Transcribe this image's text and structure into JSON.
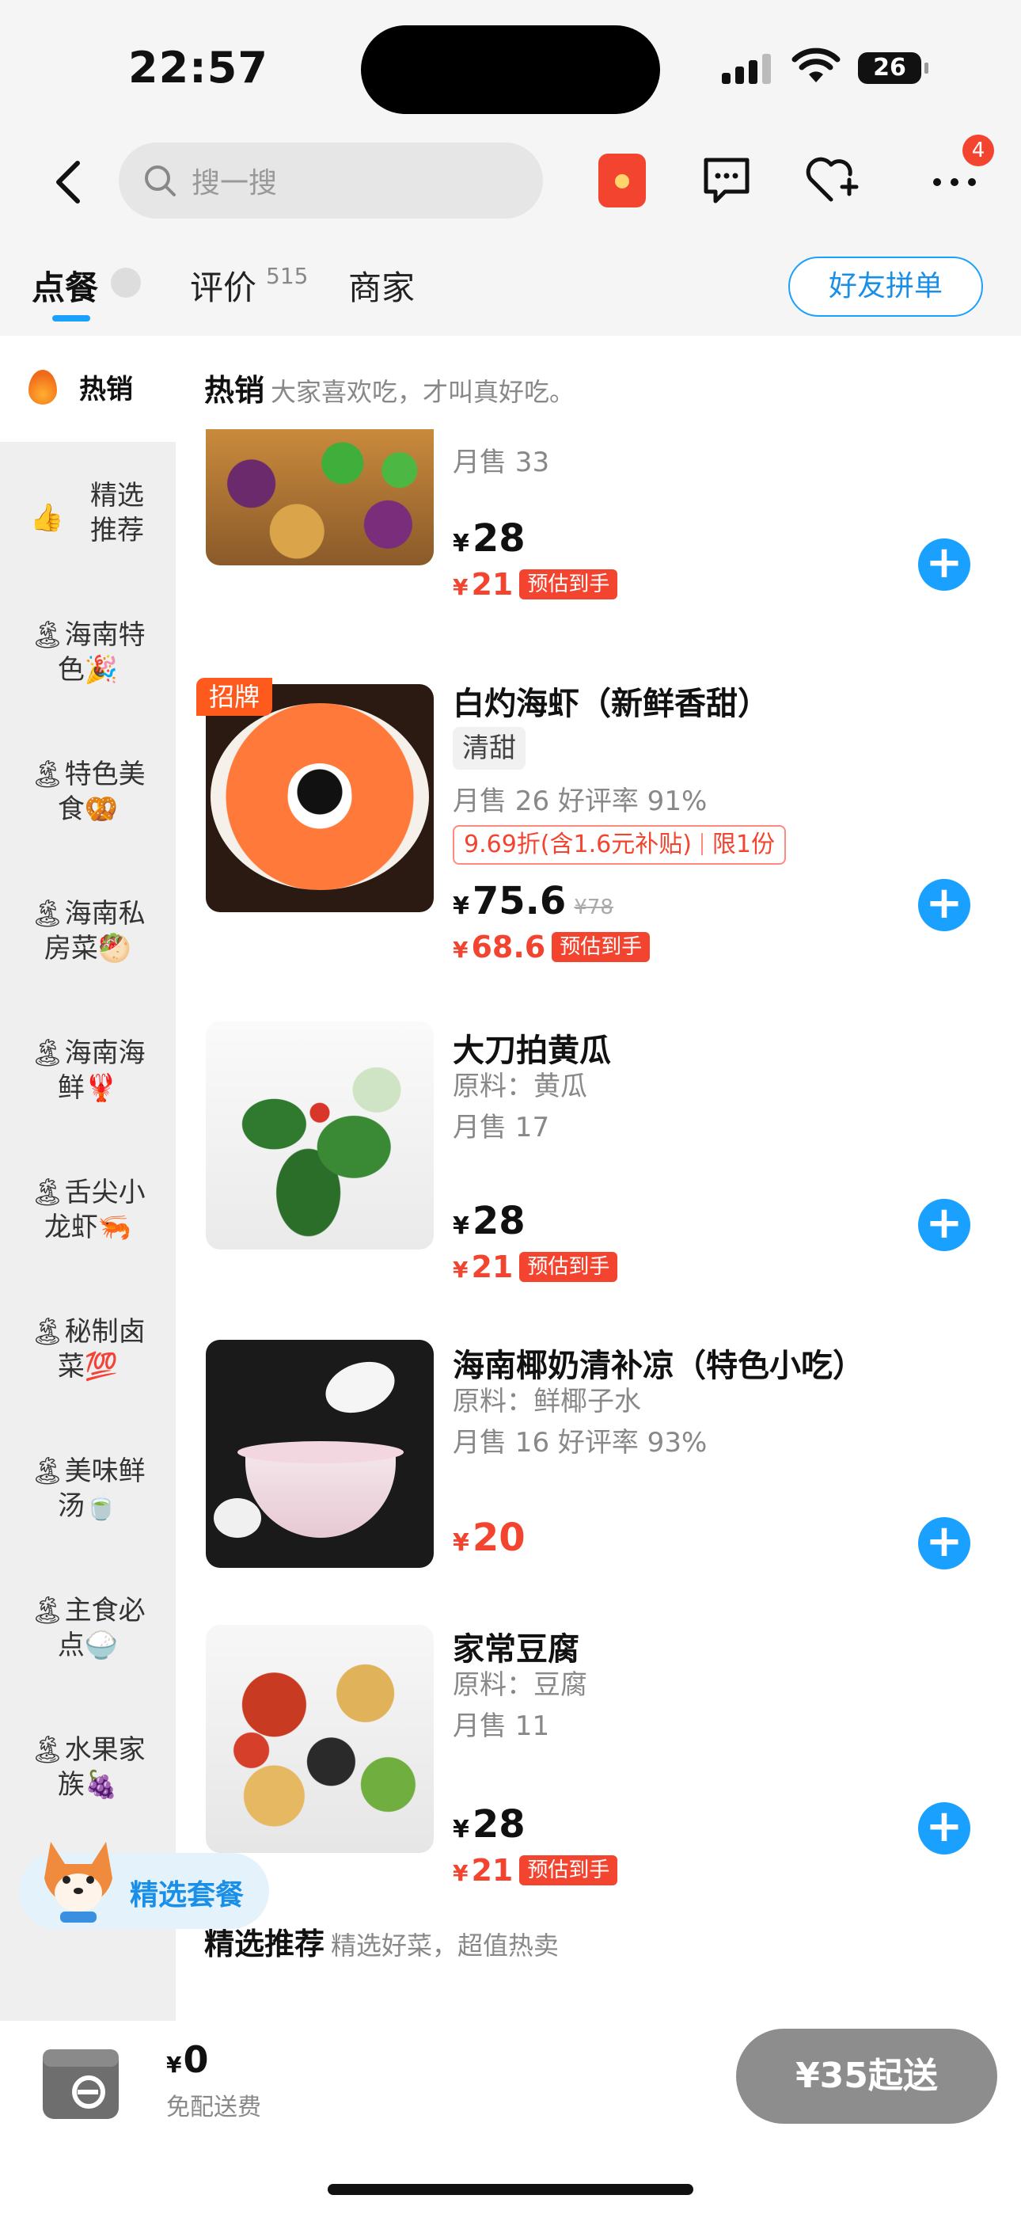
{
  "status_bar": {
    "time": "22:57",
    "battery": "26"
  },
  "nav": {
    "search_placeholder": "搜一搜",
    "notification_count": "4"
  },
  "tabs": [
    {
      "label": "点餐"
    },
    {
      "label": "评价",
      "count": "515"
    },
    {
      "label": "商家"
    }
  ],
  "friend_order_button": "好友拼单",
  "sidebar": {
    "items": [
      {
        "label": "热销"
      },
      {
        "label": "精选推荐"
      },
      {
        "label": "🏝海南特色🎉"
      },
      {
        "label": "🏝特色美食🥨"
      },
      {
        "label": "🏝海南私房菜🥙"
      },
      {
        "label": "🏝海南海鲜🦞"
      },
      {
        "label": "🏝舌尖小龙虾🦐"
      },
      {
        "label": "🏝秘制卤菜💯"
      },
      {
        "label": "🏝美味鲜汤🍵"
      },
      {
        "label": "🏝主食必点🍚"
      },
      {
        "label": "🏝水果家族🍇"
      }
    ]
  },
  "section_hot": {
    "title": "热销",
    "subtitle": "大家喜欢吃，才叫真好吃。"
  },
  "dishes": [
    {
      "name": "",
      "sold": "月售 33",
      "price": "28",
      "estimated_price": "21",
      "estimate_label": "预估到手"
    },
    {
      "badge": "招牌",
      "name": "白灼海虾（新鲜香甜）",
      "tag": "清甜",
      "sold": "月售 26 好评率 91%",
      "promo_discount": "9.69折(含1.6元补贴)",
      "promo_limit": "限1份",
      "price": "75.6",
      "original_price": "¥78",
      "estimated_price": "68.6",
      "estimate_label": "预估到手"
    },
    {
      "name": "大刀拍黄瓜",
      "ingredients": "原料：黄瓜",
      "sold": "月售 17",
      "price": "28",
      "estimated_price": "21",
      "estimate_label": "预估到手"
    },
    {
      "name": "海南椰奶清补凉（特色小吃）",
      "ingredients": "原料：鲜椰子水",
      "sold": "月售 16 好评率 93%",
      "price": "20"
    },
    {
      "name": "家常豆腐",
      "ingredients": "原料：豆腐",
      "sold": "月售 11",
      "price": "28",
      "estimated_price": "21",
      "estimate_label": "预估到手"
    }
  ],
  "section_recommend": {
    "title": "精选推荐",
    "subtitle": "精选好菜，超值热卖"
  },
  "floating_set": {
    "label": "精选套餐"
  },
  "cart": {
    "currency": "¥",
    "total": "0",
    "delivery_note": "免配送费",
    "min_order_button": "¥35起送"
  },
  "colors": {
    "accent_blue": "#1aa0ff",
    "price_red": "#f3442f",
    "badge_orange": "#ff5a1e"
  }
}
